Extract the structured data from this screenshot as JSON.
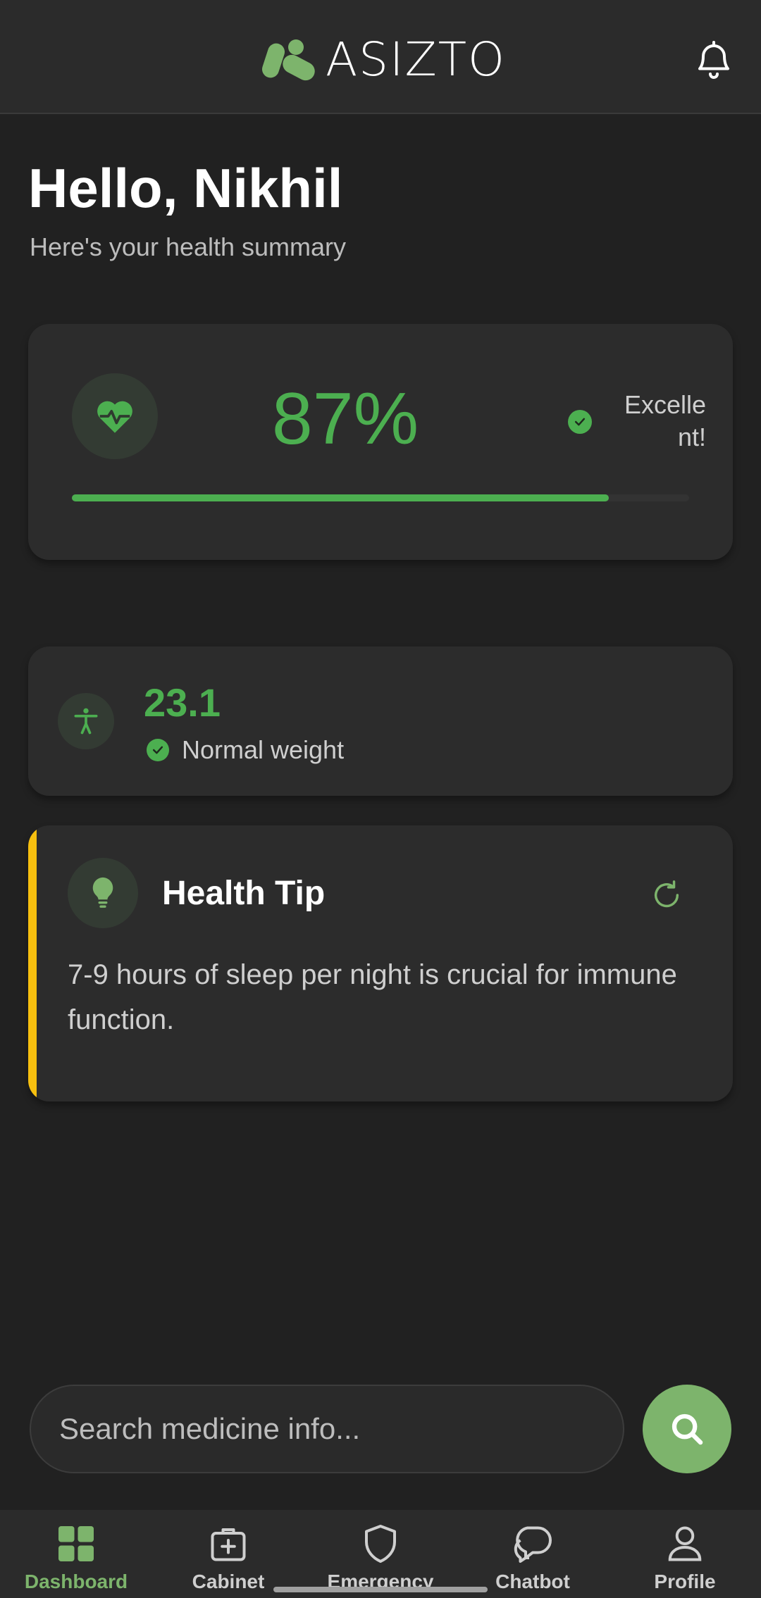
{
  "app": {
    "name": "ASIZTO",
    "brand_color": "#7db46c",
    "accent_color": "#4caf50",
    "tip_accent_color": "#f6bf0f"
  },
  "header": {
    "notification_icon": "bell-icon"
  },
  "greeting": {
    "title": "Hello, Nikhil",
    "subtitle": "Here's your health summary"
  },
  "health_score": {
    "icon": "heart-pulse-icon",
    "value": "87%",
    "percent": 87,
    "status": "Excellent!"
  },
  "bmi": {
    "icon": "person-icon",
    "value": "23.1",
    "status": "Normal weight"
  },
  "health_tip": {
    "icon": "lightbulb-icon",
    "title": "Health Tip",
    "text": "7-9 hours of sleep per night is crucial for immune function."
  },
  "search": {
    "placeholder": "Search medicine info...",
    "value": ""
  },
  "nav": {
    "items": [
      {
        "label": "Dashboard",
        "icon": "grid-icon",
        "active": true
      },
      {
        "label": "Cabinet",
        "icon": "medkit-icon",
        "active": false
      },
      {
        "label": "Emergency",
        "icon": "shield-icon",
        "active": false
      },
      {
        "label": "Chatbot",
        "icon": "chat-icon",
        "active": false
      },
      {
        "label": "Profile",
        "icon": "user-icon",
        "active": false
      }
    ]
  }
}
